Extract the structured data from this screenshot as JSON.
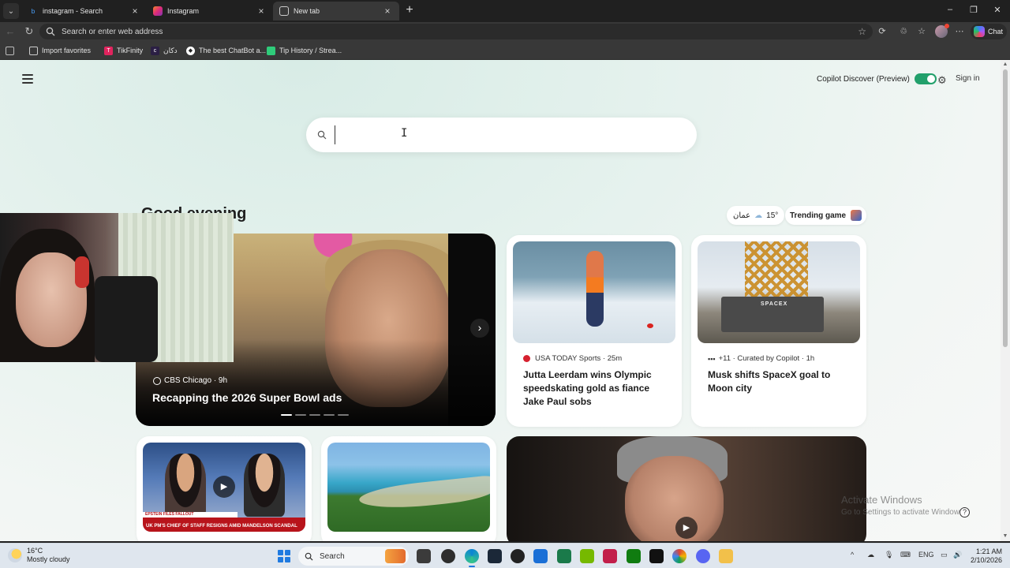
{
  "browser": {
    "tabs": [
      {
        "title": "instagram - Search",
        "active": false
      },
      {
        "title": "Instagram",
        "active": false
      },
      {
        "title": "New tab",
        "active": true
      }
    ],
    "address_placeholder": "Search or enter web address",
    "chat_label": "Chat",
    "favorites": [
      {
        "label": "Import favorites",
        "icon": "folder-icon"
      },
      {
        "label": "TikFinity",
        "icon": "tikfinity-icon"
      },
      {
        "label": "دکان",
        "icon": "dokan-icon"
      },
      {
        "label": "The best ChatBot a...",
        "icon": "chatbot-icon"
      },
      {
        "label": "Tip History / Strea...",
        "icon": "tip-history-icon"
      }
    ]
  },
  "newtab": {
    "discover_label": "Copilot Discover (Preview)",
    "discover_enabled": true,
    "signin_label": "Sign in",
    "search_placeholder": "",
    "greeting": "Good evening",
    "weather": {
      "city": "عمان",
      "temp": "15°"
    },
    "trending_label": "Trending game",
    "hero": {
      "source": "CBS Chicago",
      "age": "· 9h",
      "headline": "Recapping the 2026 Super Bowl ads",
      "slides": 5,
      "active_slide": 0
    },
    "cards": [
      {
        "source": "USA TODAY Sports",
        "age": "· 25m",
        "title": "Jutta Leerdam wins Olympic speedskating gold as fiance Jake Paul sobs"
      },
      {
        "source": "+11 · Curated by Copilot",
        "age": "· 1h",
        "title": "Musk shifts SpaceX goal to Moon city",
        "thumb_sign": "SPACEX"
      }
    ],
    "small_cards": [
      {
        "thumb_ticker_top": "EPSTEIN FILES FALLOUT",
        "thumb_ticker": "UK PM'S CHIEF OF STAFF RESIGNS AMID MANDELSON SCANDAL",
        "video": true
      },
      {
        "video": false
      }
    ],
    "watermark": {
      "line1": "Activate Windows",
      "line2": "Go to Settings to activate Windows."
    }
  },
  "taskbar": {
    "weather_temp": "16°C",
    "weather_desc": "Mostly cloudy",
    "search_label": "Search",
    "language": "ENG",
    "time": "1:21 AM",
    "date": "2/10/2026",
    "apps": [
      "file-explorer-icon",
      "settings-icon",
      "edge-icon",
      "steam-icon",
      "obs-icon",
      "store-icon",
      "app-icon",
      "nvidia-icon",
      "streaming-icon",
      "xbox-icon",
      "tiktok-icon",
      "chrome-icon",
      "discord-icon",
      "folder-icon"
    ]
  }
}
